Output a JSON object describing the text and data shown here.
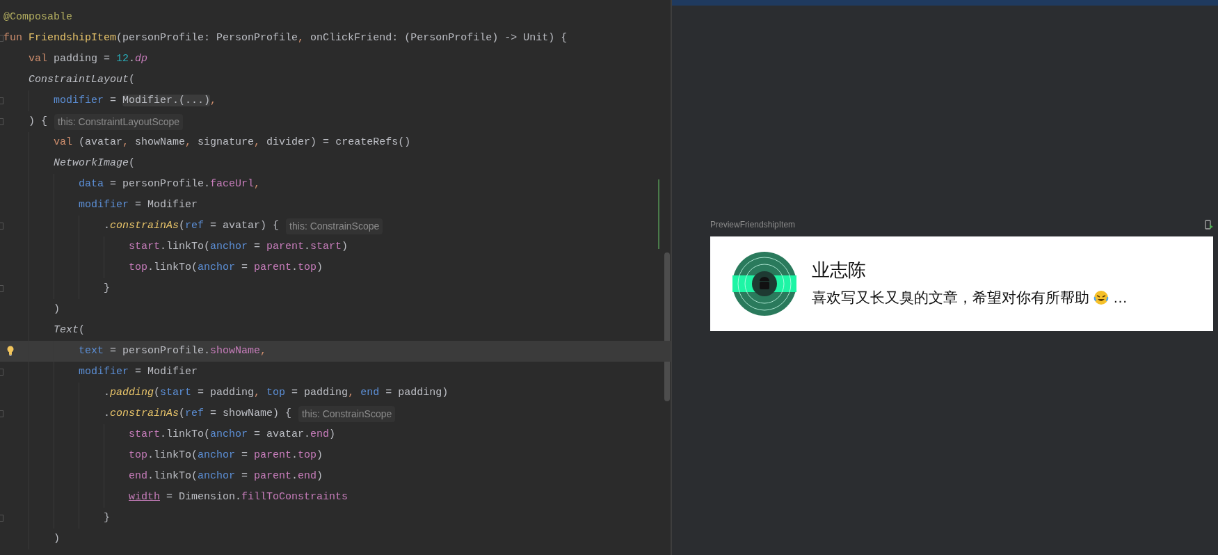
{
  "editor": {
    "lines": [
      {
        "current": false,
        "fold": false,
        "bulb": false,
        "tokens": [
          {
            "text": "@Composable",
            "kind": "annotation"
          }
        ]
      },
      {
        "current": false,
        "fold": true,
        "bulb": false,
        "tokens": [
          {
            "text": "fun",
            "kind": "keyword"
          },
          {
            "text": " FriendshipItem",
            "kind": "function"
          },
          {
            "text": "(personProfile: PersonProfile",
            "kind": "plain"
          },
          {
            "text": ",",
            "kind": "punct"
          },
          {
            "text": " onClickFriend: (PersonProfile) -> Unit) {",
            "kind": "plain"
          }
        ]
      },
      {
        "current": false,
        "fold": false,
        "bulb": false,
        "tokens": [
          {
            "text": "    val",
            "kind": "keyword"
          },
          {
            "text": " padding = ",
            "kind": "plain"
          },
          {
            "text": "12",
            "kind": "number"
          },
          {
            "text": ".",
            "kind": "plain"
          },
          {
            "text": "dp",
            "kind": "extension-property"
          }
        ]
      },
      {
        "current": false,
        "fold": false,
        "bulb": false,
        "tokens": [
          {
            "text": "    ConstraintLayout",
            "kind": "call"
          },
          {
            "text": "(",
            "kind": "plain"
          }
        ]
      },
      {
        "current": false,
        "fold": true,
        "bulb": false,
        "tokens": [
          {
            "text": "        modifier",
            "kind": "param"
          },
          {
            "text": " = ",
            "kind": "plain"
          },
          {
            "text": "Modifier.(...)",
            "kind": "folded"
          },
          {
            "text": ",",
            "kind": "punct"
          }
        ]
      },
      {
        "current": false,
        "fold": true,
        "bulb": false,
        "tokens": [
          {
            "text": "    ) {",
            "kind": "plain"
          }
        ],
        "hint": "this: ConstraintLayoutScope"
      },
      {
        "current": false,
        "fold": false,
        "bulb": false,
        "tokens": [
          {
            "text": "        val",
            "kind": "keyword"
          },
          {
            "text": " (avatar",
            "kind": "plain"
          },
          {
            "text": ",",
            "kind": "punct"
          },
          {
            "text": " showName",
            "kind": "plain"
          },
          {
            "text": ",",
            "kind": "punct"
          },
          {
            "text": " signature",
            "kind": "plain"
          },
          {
            "text": ",",
            "kind": "punct"
          },
          {
            "text": " divider) = createRefs()",
            "kind": "plain"
          }
        ]
      },
      {
        "current": false,
        "fold": false,
        "bulb": false,
        "tokens": [
          {
            "text": "        NetworkImage",
            "kind": "call"
          },
          {
            "text": "(",
            "kind": "plain"
          }
        ]
      },
      {
        "current": false,
        "fold": false,
        "bulb": false,
        "tokens": [
          {
            "text": "            data",
            "kind": "param"
          },
          {
            "text": " = personProfile.",
            "kind": "plain"
          },
          {
            "text": "faceUrl",
            "kind": "property"
          },
          {
            "text": ",",
            "kind": "punct"
          }
        ]
      },
      {
        "current": false,
        "fold": false,
        "bulb": false,
        "tokens": [
          {
            "text": "            modifier",
            "kind": "param"
          },
          {
            "text": " = Modifier",
            "kind": "plain"
          }
        ]
      },
      {
        "current": false,
        "fold": true,
        "bulb": false,
        "tokens": [
          {
            "text": "                .",
            "kind": "plain"
          },
          {
            "text": "constrainAs",
            "kind": "extension"
          },
          {
            "text": "(",
            "kind": "plain"
          },
          {
            "text": "ref",
            "kind": "param"
          },
          {
            "text": " = avatar) {",
            "kind": "plain"
          }
        ],
        "hint": "this: ConstrainScope"
      },
      {
        "current": false,
        "fold": false,
        "bulb": false,
        "tokens": [
          {
            "text": "                    start",
            "kind": "property"
          },
          {
            "text": ".linkTo(",
            "kind": "plain"
          },
          {
            "text": "anchor",
            "kind": "param"
          },
          {
            "text": " = ",
            "kind": "plain"
          },
          {
            "text": "parent",
            "kind": "property"
          },
          {
            "text": ".",
            "kind": "plain"
          },
          {
            "text": "start",
            "kind": "property"
          },
          {
            "text": ")",
            "kind": "plain"
          }
        ]
      },
      {
        "current": false,
        "fold": false,
        "bulb": false,
        "tokens": [
          {
            "text": "                    top",
            "kind": "property"
          },
          {
            "text": ".linkTo(",
            "kind": "plain"
          },
          {
            "text": "anchor",
            "kind": "param"
          },
          {
            "text": " = ",
            "kind": "plain"
          },
          {
            "text": "parent",
            "kind": "property"
          },
          {
            "text": ".",
            "kind": "plain"
          },
          {
            "text": "top",
            "kind": "property"
          },
          {
            "text": ")",
            "kind": "plain"
          }
        ]
      },
      {
        "current": false,
        "fold": true,
        "bulb": false,
        "tokens": [
          {
            "text": "                }",
            "kind": "plain"
          }
        ]
      },
      {
        "current": false,
        "fold": false,
        "bulb": false,
        "tokens": [
          {
            "text": "        )",
            "kind": "plain"
          }
        ]
      },
      {
        "current": false,
        "fold": false,
        "bulb": false,
        "tokens": [
          {
            "text": "        Text",
            "kind": "call"
          },
          {
            "text": "(",
            "kind": "plain"
          }
        ]
      },
      {
        "current": true,
        "fold": false,
        "bulb": true,
        "tokens": [
          {
            "text": "            text",
            "kind": "param"
          },
          {
            "text": " = personProfile.",
            "kind": "plain"
          },
          {
            "text": "showName",
            "kind": "property"
          },
          {
            "text": ",",
            "kind": "punct"
          }
        ]
      },
      {
        "current": false,
        "fold": true,
        "bulb": false,
        "tokens": [
          {
            "text": "            modifier",
            "kind": "param"
          },
          {
            "text": " = Modifier",
            "kind": "plain"
          }
        ]
      },
      {
        "current": false,
        "fold": false,
        "bulb": false,
        "tokens": [
          {
            "text": "                .",
            "kind": "plain"
          },
          {
            "text": "padding",
            "kind": "extension"
          },
          {
            "text": "(",
            "kind": "plain"
          },
          {
            "text": "start",
            "kind": "param"
          },
          {
            "text": " = padding",
            "kind": "plain"
          },
          {
            "text": ", ",
            "kind": "punct"
          },
          {
            "text": "top",
            "kind": "param"
          },
          {
            "text": " = padding",
            "kind": "plain"
          },
          {
            "text": ", ",
            "kind": "punct"
          },
          {
            "text": "end",
            "kind": "param"
          },
          {
            "text": " = padding)",
            "kind": "plain"
          }
        ]
      },
      {
        "current": false,
        "fold": true,
        "bulb": false,
        "tokens": [
          {
            "text": "                .",
            "kind": "plain"
          },
          {
            "text": "constrainAs",
            "kind": "extension"
          },
          {
            "text": "(",
            "kind": "plain"
          },
          {
            "text": "ref",
            "kind": "param"
          },
          {
            "text": " = showName) {",
            "kind": "plain"
          }
        ],
        "hint": "this: ConstrainScope"
      },
      {
        "current": false,
        "fold": false,
        "bulb": false,
        "tokens": [
          {
            "text": "                    start",
            "kind": "property"
          },
          {
            "text": ".linkTo(",
            "kind": "plain"
          },
          {
            "text": "anchor",
            "kind": "param"
          },
          {
            "text": " = avatar.",
            "kind": "plain"
          },
          {
            "text": "end",
            "kind": "property"
          },
          {
            "text": ")",
            "kind": "plain"
          }
        ]
      },
      {
        "current": false,
        "fold": false,
        "bulb": false,
        "tokens": [
          {
            "text": "                    top",
            "kind": "property"
          },
          {
            "text": ".linkTo(",
            "kind": "plain"
          },
          {
            "text": "anchor",
            "kind": "param"
          },
          {
            "text": " = ",
            "kind": "plain"
          },
          {
            "text": "parent",
            "kind": "property"
          },
          {
            "text": ".",
            "kind": "plain"
          },
          {
            "text": "top",
            "kind": "property"
          },
          {
            "text": ")",
            "kind": "plain"
          }
        ]
      },
      {
        "current": false,
        "fold": false,
        "bulb": false,
        "tokens": [
          {
            "text": "                    end",
            "kind": "property"
          },
          {
            "text": ".linkTo(",
            "kind": "plain"
          },
          {
            "text": "anchor",
            "kind": "param"
          },
          {
            "text": " = ",
            "kind": "plain"
          },
          {
            "text": "parent",
            "kind": "property"
          },
          {
            "text": ".",
            "kind": "plain"
          },
          {
            "text": "end",
            "kind": "property"
          },
          {
            "text": ")",
            "kind": "plain"
          }
        ]
      },
      {
        "current": false,
        "fold": false,
        "bulb": false,
        "tokens": [
          {
            "text": "                    width",
            "kind": "underlined"
          },
          {
            "text": " = Dimension.",
            "kind": "plain"
          },
          {
            "text": "fillToConstraints",
            "kind": "property"
          }
        ]
      },
      {
        "current": false,
        "fold": true,
        "bulb": false,
        "tokens": [
          {
            "text": "                }",
            "kind": "plain"
          }
        ]
      },
      {
        "current": false,
        "fold": false,
        "bulb": false,
        "tokens": [
          {
            "text": "        )",
            "kind": "plain"
          }
        ]
      }
    ]
  },
  "preview": {
    "title": "PreviewFriendshipItem",
    "name": "业志陈",
    "signature": "喜欢写又长又臭的文章，希望对你有所帮助",
    "ellipsis": "…"
  }
}
